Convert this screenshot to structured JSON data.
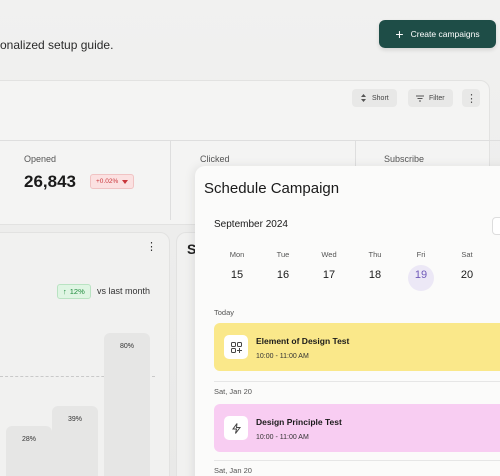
{
  "header": {
    "subtitle": "onalized setup guide.",
    "create_label": "Create campaigns",
    "create_icon": "plus-icon"
  },
  "toolbar": {
    "sort_label": "Short",
    "filter_label": "Filter"
  },
  "stats": [
    {
      "label": "Opened",
      "value": "26,843",
      "delta": "+0.02%"
    },
    {
      "label": "Clicked"
    },
    {
      "label": "Subscribe"
    }
  ],
  "chart": {
    "growth": "12%",
    "vs_text": "vs last month",
    "bars": [
      "28%",
      "39%",
      "80%"
    ],
    "second_card_initial": "S"
  },
  "chart_data": {
    "type": "bar",
    "categories": [
      "",
      "",
      ""
    ],
    "values": [
      28,
      39,
      80
    ]
  },
  "schedule": {
    "title": "Schedule Campaign",
    "month": "September 2024",
    "days": [
      {
        "name": "Mon",
        "date": "15"
      },
      {
        "name": "Tue",
        "date": "16"
      },
      {
        "name": "Wed",
        "date": "17"
      },
      {
        "name": "Thu",
        "date": "18"
      },
      {
        "name": "Fri",
        "date": "19",
        "selected": true
      },
      {
        "name": "Sat",
        "date": "20"
      }
    ],
    "sections": [
      {
        "label": "Today",
        "event": {
          "title": "Element of Design Test",
          "time": "10:00 - 11:00 AM",
          "color": "#fae88a",
          "icon": "grid-icon"
        }
      },
      {
        "label": "Sat, Jan 20",
        "event": {
          "title": "Design Principle Test",
          "time": "10:00 - 11:00 AM",
          "color": "#f8cdf2",
          "icon": "bolt-icon"
        }
      },
      {
        "label": "Sat, Jan 20"
      }
    ]
  },
  "colors": {
    "accent": "#1e4d47",
    "selected_day": "#6f59b8",
    "badge_up": "#1e8a3c",
    "badge_down": "#c8353a"
  }
}
